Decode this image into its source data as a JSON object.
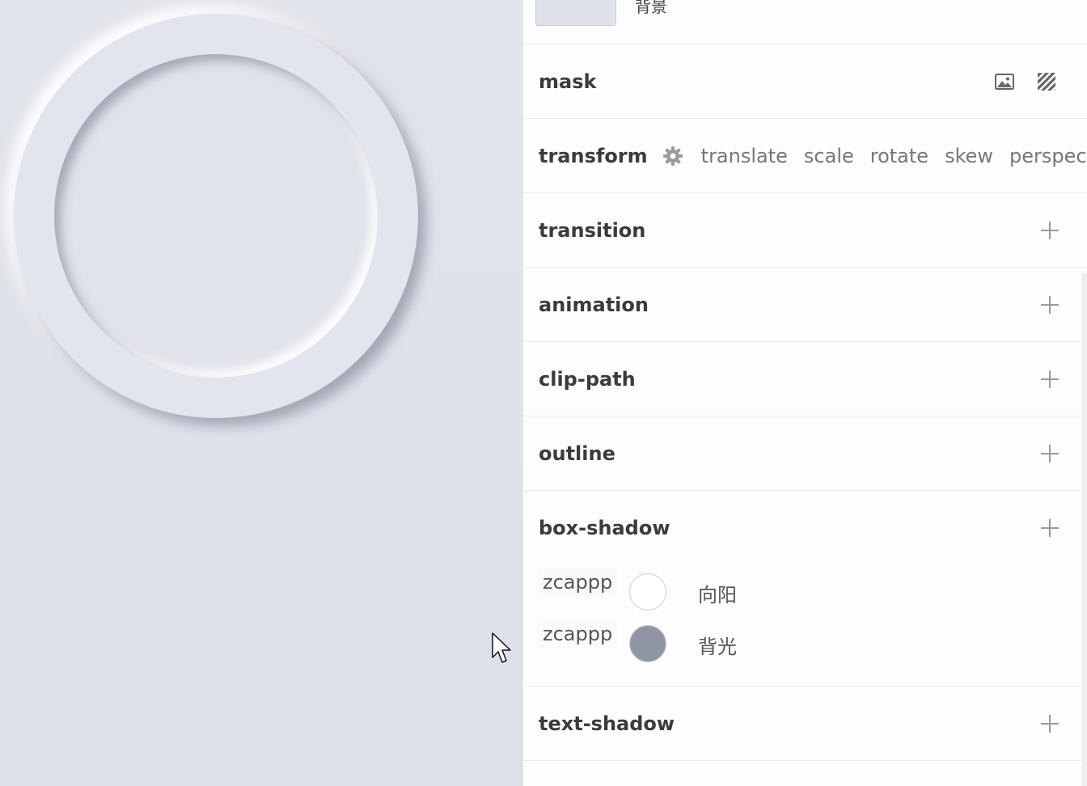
{
  "top": {
    "background_label": "背景"
  },
  "sections": {
    "mask": "mask",
    "transform": "transform",
    "transition": "transition",
    "animation": "animation",
    "clip_path": "clip-path",
    "outline": "outline",
    "box_shadow": "box-shadow",
    "text_shadow": "text-shadow"
  },
  "transform_ops": [
    "translate",
    "scale",
    "rotate",
    "skew",
    "perspective"
  ],
  "box_shadow_items": [
    {
      "name": "zcappp",
      "color": "#ffffff",
      "label": "向阳"
    },
    {
      "name": "zcappp",
      "color": "#8e96a3",
      "label": "背光"
    }
  ],
  "colors": {
    "canvas_bg": "#dfe2e9",
    "background_swatch": "#dfe2ea"
  },
  "icons": {
    "mask_image": "image-icon",
    "mask_pattern": "hatch-pattern-icon",
    "transform_settings": "gear-icon",
    "add": "plus-icon"
  }
}
